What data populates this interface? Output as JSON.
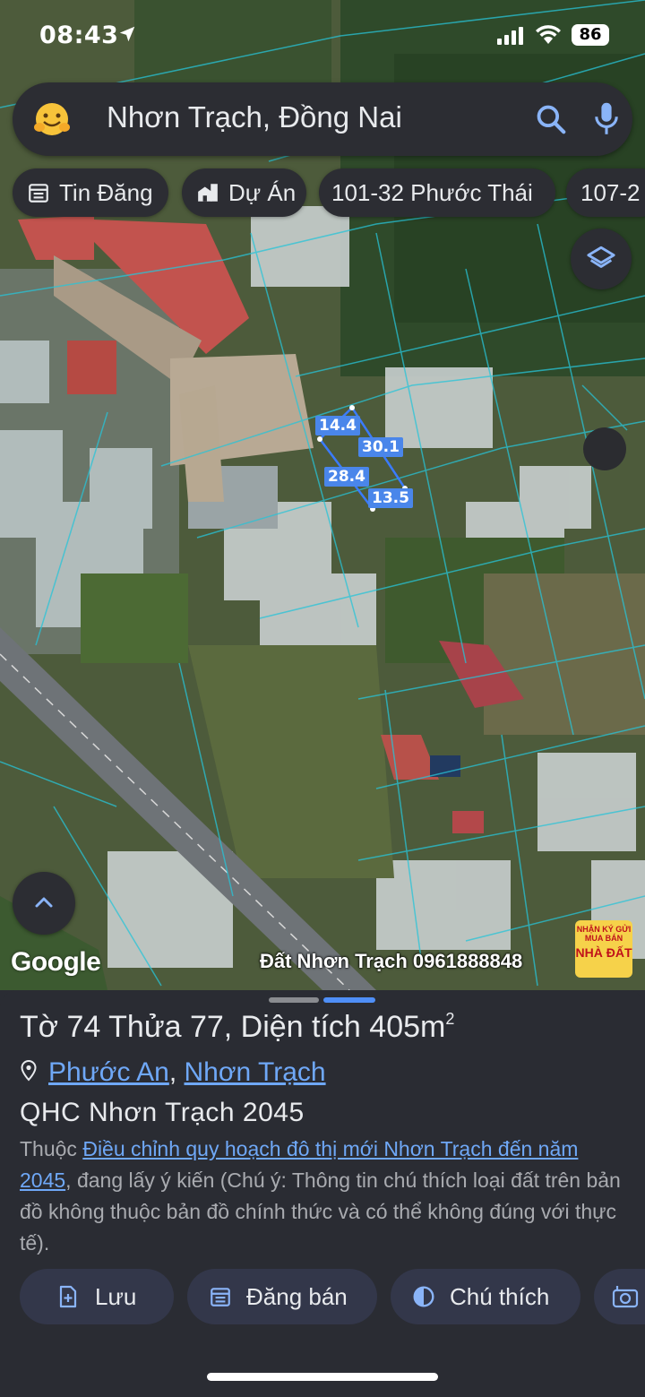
{
  "status_bar": {
    "time": "08:43",
    "battery": "86"
  },
  "search": {
    "query": "Nhơn Trạch, Đồng Nai"
  },
  "chips": [
    {
      "label": "Tin Đăng",
      "icon": "calendar-list-icon"
    },
    {
      "label": "Dự Án",
      "icon": "buildings-icon"
    },
    {
      "label": "101-32 Phước Thái",
      "icon": ""
    },
    {
      "label": "107-2",
      "icon": ""
    }
  ],
  "map": {
    "provider": "Google",
    "watermark": "Đất Nhơn Trạch 0961888848",
    "ad_badge": {
      "line1": "NHẬN KÝ GỬI",
      "line2": "MUA BÁN",
      "line3": "NHÀ ĐẤT"
    },
    "parcel_edges": [
      "14.4",
      "30.1",
      "28.4",
      "13.5"
    ]
  },
  "sheet": {
    "title_main": "Tờ 74 Thửa 77, Diện tích 405m",
    "title_sup": "2",
    "location": {
      "ward": "Phước An",
      "separator": ", ",
      "district": "Nhơn Trạch"
    },
    "plan_name": "QHC Nhơn Trạch 2045",
    "desc_prefix": "Thuộc ",
    "desc_link": "Điều chỉnh quy hoạch đô thị mới Nhơn Trạch đến năm 2045",
    "desc_suffix": ", đang lấy ý kiến (Chú ý: Thông tin chú thích loại đất trên bản đồ không thuộc bản đồ chính thức và có thể không đúng với thực tế).",
    "actions": [
      {
        "label": "Lưu",
        "icon": "save-add-icon"
      },
      {
        "label": "Đăng bán",
        "icon": "calendar-list-icon"
      },
      {
        "label": "Chú thích",
        "icon": "contrast-icon"
      },
      {
        "label": "",
        "icon": "add-photo-icon"
      }
    ]
  },
  "colors": {
    "accent": "#4f8ff7",
    "sheet_bg": "#2a2c33",
    "link": "#6fa8f7",
    "parcel_label": "#4a86ea"
  }
}
